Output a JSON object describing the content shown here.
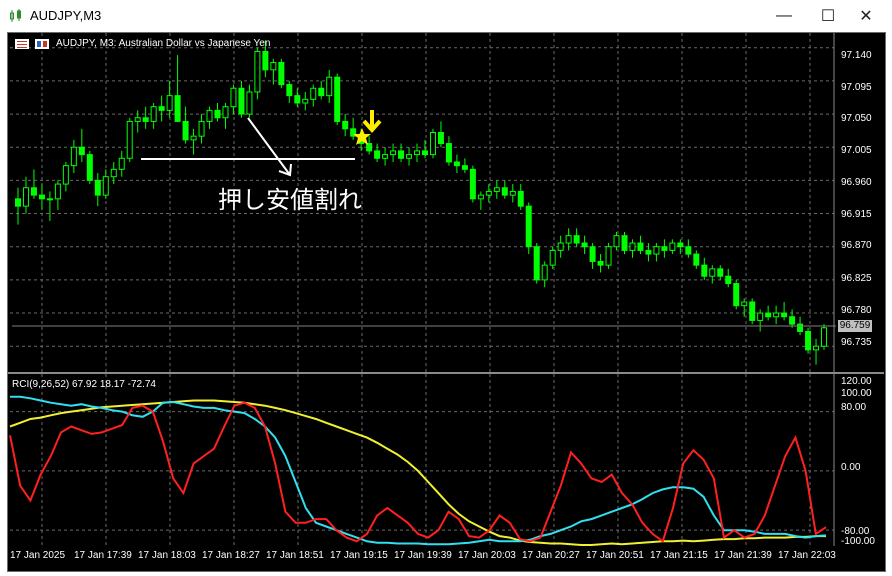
{
  "window": {
    "title": "AUDJPY,M3",
    "buttons": {
      "minimize": "—",
      "maximize": "☐",
      "close": "✕"
    }
  },
  "chart": {
    "title": "AUDJPY, M3:  Australian Dollar vs Japanese Yen",
    "price_axis": [
      "97.140",
      "97.095",
      "97.050",
      "97.005",
      "96.960",
      "96.915",
      "96.870",
      "96.825",
      "96.780",
      "96.735"
    ],
    "current_price": "96.759",
    "annotation": "押し安値割れ",
    "colors": {
      "background": "#000000",
      "grid": "#6a6a6a",
      "candle": "#00ff00",
      "annotation": "#ffffff",
      "marker": "#ffee00"
    }
  },
  "indicator": {
    "label": "RCI(9,26,52) 67.92 18.17 -72.74",
    "axis": [
      "120.00",
      "100.00",
      "80.00",
      "0.00",
      "-80.00",
      "-100.00"
    ],
    "series_colors": {
      "short": "#ff2020",
      "mid": "#30e0f0",
      "long": "#f0f030"
    }
  },
  "time_axis": [
    "17 Jan 2025",
    "17 Jan 17:39",
    "17 Jan 18:03",
    "17 Jan 18:27",
    "17 Jan 18:51",
    "17 Jan 19:15",
    "17 Jan 19:39",
    "17 Jan 20:03",
    "17 Jan 20:27",
    "17 Jan 20:51",
    "17 Jan 21:15",
    "17 Jan 21:39",
    "17 Jan 22:03"
  ],
  "chart_data": {
    "type": "candlestick",
    "symbol": "AUDJPY",
    "timeframe": "M3",
    "ylim": [
      96.7,
      97.16
    ],
    "current_price": 96.759,
    "candles": [
      [
        96.935,
        96.95,
        96.9,
        96.925
      ],
      [
        96.925,
        96.965,
        96.915,
        96.95
      ],
      [
        96.95,
        96.975,
        96.935,
        96.94
      ],
      [
        96.94,
        96.955,
        96.92,
        96.935
      ],
      [
        96.935,
        96.945,
        96.905,
        96.935
      ],
      [
        96.935,
        96.96,
        96.92,
        96.955
      ],
      [
        96.955,
        96.985,
        96.945,
        96.98
      ],
      [
        96.98,
        97.015,
        96.97,
        97.005
      ],
      [
        97.005,
        97.03,
        96.985,
        96.995
      ],
      [
        96.995,
        97.0,
        96.955,
        96.96
      ],
      [
        96.96,
        96.97,
        96.925,
        96.94
      ],
      [
        96.94,
        96.975,
        96.935,
        96.965
      ],
      [
        96.965,
        96.985,
        96.955,
        96.975
      ],
      [
        96.975,
        97.0,
        96.965,
        96.99
      ],
      [
        96.99,
        97.045,
        96.985,
        97.04
      ],
      [
        97.04,
        97.055,
        97.025,
        97.045
      ],
      [
        97.045,
        97.06,
        97.03,
        97.04
      ],
      [
        97.04,
        97.065,
        97.03,
        97.06
      ],
      [
        97.06,
        97.075,
        97.04,
        97.055
      ],
      [
        97.055,
        97.095,
        97.045,
        97.075
      ],
      [
        97.075,
        97.13,
        97.06,
        97.04
      ],
      [
        97.04,
        97.06,
        97.01,
        97.015
      ],
      [
        97.015,
        97.03,
        96.995,
        97.02
      ],
      [
        97.02,
        97.05,
        97.01,
        97.04
      ],
      [
        97.04,
        97.06,
        97.03,
        97.055
      ],
      [
        97.055,
        97.065,
        97.04,
        97.045
      ],
      [
        97.045,
        97.065,
        97.03,
        97.06
      ],
      [
        97.06,
        97.09,
        97.05,
        97.085
      ],
      [
        97.085,
        97.095,
        97.045,
        97.05
      ],
      [
        97.05,
        97.09,
        97.045,
        97.08
      ],
      [
        97.08,
        97.14,
        97.07,
        97.135
      ],
      [
        97.135,
        97.15,
        97.1,
        97.11
      ],
      [
        97.11,
        97.125,
        97.09,
        97.12
      ],
      [
        97.12,
        97.125,
        97.085,
        97.09
      ],
      [
        97.09,
        97.095,
        97.065,
        97.075
      ],
      [
        97.075,
        97.085,
        97.06,
        97.065
      ],
      [
        97.065,
        97.08,
        97.055,
        97.07
      ],
      [
        97.07,
        97.09,
        97.06,
        97.085
      ],
      [
        97.085,
        97.095,
        97.07,
        97.075
      ],
      [
        97.075,
        97.11,
        97.065,
        97.1
      ],
      [
        97.1,
        97.105,
        97.035,
        97.04
      ],
      [
        97.04,
        97.05,
        97.02,
        97.03
      ],
      [
        97.03,
        97.045,
        97.015,
        97.02
      ],
      [
        97.02,
        97.03,
        97.0,
        97.01
      ],
      [
        97.01,
        97.02,
        96.995,
        97.0
      ],
      [
        97.0,
        97.01,
        96.985,
        96.99
      ],
      [
        96.99,
        97.005,
        96.98,
        96.995
      ],
      [
        96.995,
        97.01,
        96.985,
        97.0
      ],
      [
        97.0,
        97.01,
        96.985,
        96.99
      ],
      [
        96.99,
        97.005,
        96.98,
        96.995
      ],
      [
        96.995,
        97.01,
        96.985,
        97.0
      ],
      [
        97.0,
        97.015,
        96.99,
        96.995
      ],
      [
        96.995,
        97.03,
        96.99,
        97.025
      ],
      [
        97.025,
        97.04,
        97.005,
        97.01
      ],
      [
        97.01,
        97.02,
        96.98,
        96.985
      ],
      [
        96.985,
        96.995,
        96.97,
        96.98
      ],
      [
        96.98,
        96.99,
        96.97,
        96.975
      ],
      [
        96.975,
        96.98,
        96.93,
        96.935
      ],
      [
        96.935,
        96.945,
        96.92,
        96.94
      ],
      [
        96.94,
        96.955,
        96.93,
        96.945
      ],
      [
        96.945,
        96.96,
        96.935,
        96.95
      ],
      [
        96.95,
        96.96,
        96.935,
        96.94
      ],
      [
        96.94,
        96.955,
        96.93,
        96.945
      ],
      [
        96.945,
        96.955,
        96.92,
        96.925
      ],
      [
        96.925,
        96.93,
        96.86,
        96.87
      ],
      [
        96.87,
        96.875,
        96.82,
        96.825
      ],
      [
        96.825,
        96.85,
        96.815,
        96.845
      ],
      [
        96.845,
        96.87,
        96.84,
        96.865
      ],
      [
        96.865,
        96.885,
        96.855,
        96.875
      ],
      [
        96.875,
        96.895,
        96.865,
        96.885
      ],
      [
        96.885,
        96.895,
        96.87,
        96.875
      ],
      [
        96.875,
        96.885,
        96.86,
        96.87
      ],
      [
        96.87,
        96.875,
        96.84,
        96.85
      ],
      [
        96.85,
        96.86,
        96.835,
        96.845
      ],
      [
        96.845,
        96.875,
        96.84,
        96.87
      ],
      [
        96.87,
        96.89,
        96.865,
        96.885
      ],
      [
        96.885,
        96.89,
        96.86,
        96.865
      ],
      [
        96.865,
        96.88,
        96.855,
        96.875
      ],
      [
        96.875,
        96.885,
        96.86,
        96.865
      ],
      [
        96.865,
        96.875,
        96.85,
        96.86
      ],
      [
        96.86,
        96.875,
        96.85,
        96.87
      ],
      [
        96.87,
        96.88,
        96.855,
        96.865
      ],
      [
        96.865,
        96.88,
        96.86,
        96.875
      ],
      [
        96.875,
        96.88,
        96.86,
        96.87
      ],
      [
        96.87,
        96.88,
        96.855,
        96.86
      ],
      [
        96.86,
        96.865,
        96.84,
        96.845
      ],
      [
        96.845,
        96.855,
        96.825,
        96.83
      ],
      [
        96.83,
        96.845,
        96.82,
        96.84
      ],
      [
        96.84,
        96.845,
        96.825,
        96.83
      ],
      [
        96.83,
        96.84,
        96.815,
        96.82
      ],
      [
        96.82,
        96.825,
        96.785,
        96.79
      ],
      [
        96.79,
        96.8,
        96.775,
        96.795
      ],
      [
        96.795,
        96.8,
        96.765,
        96.77
      ],
      [
        96.77,
        96.785,
        96.755,
        96.78
      ],
      [
        96.78,
        96.79,
        96.77,
        96.775
      ],
      [
        96.775,
        96.79,
        96.765,
        96.78
      ],
      [
        96.78,
        96.795,
        96.77,
        96.775
      ],
      [
        96.775,
        96.785,
        96.76,
        96.765
      ],
      [
        96.765,
        96.775,
        96.75,
        96.755
      ],
      [
        96.755,
        96.76,
        96.725,
        96.73
      ],
      [
        96.73,
        96.745,
        96.71,
        96.735
      ],
      [
        96.735,
        96.765,
        96.73,
        96.76
      ]
    ],
    "rci_scale": [
      -100,
      120
    ],
    "rci_series": [
      {
        "name": "RCI 9",
        "values": [
          48,
          -20,
          -40,
          -5,
          20,
          52,
          60,
          55,
          50,
          52,
          57,
          62,
          85,
          88,
          80,
          40,
          -10,
          -30,
          10,
          20,
          30,
          60,
          88,
          92,
          85,
          60,
          10,
          -55,
          -70,
          -70,
          -65,
          -65,
          -80,
          -90,
          -95,
          -85,
          -60,
          -50,
          -60,
          -70,
          -85,
          -90,
          -80,
          -55,
          -65,
          -88,
          -90,
          -80,
          -60,
          -70,
          -92,
          -95,
          -90,
          -55,
          -20,
          25,
          10,
          -10,
          -15,
          -5,
          -30,
          -45,
          -70,
          -85,
          -95,
          -50,
          10,
          28,
          15,
          -10,
          -90,
          -80,
          -90,
          -85,
          -60,
          -20,
          20,
          45,
          0,
          -85,
          -76
        ]
      },
      {
        "name": "RCI 26",
        "values": [
          100,
          100,
          98,
          95,
          92,
          90,
          88,
          90,
          87,
          85,
          82,
          80,
          75,
          73,
          80,
          92,
          93,
          90,
          87,
          85,
          85,
          82,
          80,
          78,
          70,
          60,
          45,
          20,
          -15,
          -50,
          -70,
          -75,
          -80,
          -85,
          -90,
          -95,
          -97,
          -97,
          -98,
          -98,
          -98,
          -99,
          -99,
          -99,
          -98,
          -97,
          -95,
          -93,
          -95,
          -95,
          -95,
          -93,
          -88,
          -85,
          -80,
          -75,
          -68,
          -65,
          -60,
          -55,
          -50,
          -45,
          -38,
          -30,
          -25,
          -22,
          -22,
          -24,
          -35,
          -60,
          -80,
          -80,
          -80,
          -82,
          -85,
          -85,
          -85,
          -88,
          -90,
          -88,
          -87
        ]
      },
      {
        "name": "RCI 52",
        "values": [
          60,
          65,
          70,
          72,
          75,
          78,
          80,
          82,
          84,
          86,
          87,
          88,
          89,
          90,
          91,
          92,
          93,
          94,
          95,
          95,
          95,
          94,
          93,
          92,
          90,
          88,
          85,
          82,
          78,
          74,
          70,
          65,
          60,
          55,
          50,
          45,
          38,
          30,
          22,
          12,
          0,
          -15,
          -30,
          -45,
          -58,
          -68,
          -75,
          -82,
          -88,
          -90,
          -94,
          -96,
          -97,
          -98,
          -98,
          -99,
          -100,
          -100,
          -99,
          -98,
          -99,
          -98,
          -97,
          -96,
          -95,
          -95,
          -94,
          -95,
          -94,
          -93,
          -92,
          -92,
          -91,
          -91,
          -90,
          -90,
          -90,
          -89,
          -89,
          -88,
          -88
        ]
      }
    ]
  }
}
